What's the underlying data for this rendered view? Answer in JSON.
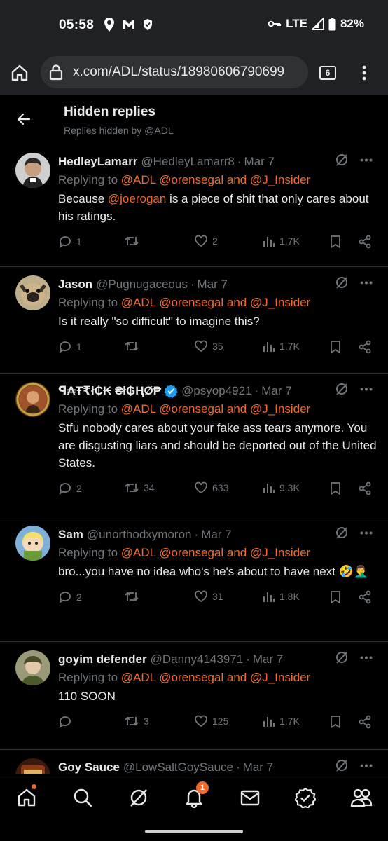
{
  "status_bar": {
    "time": "05:58",
    "network": "LTE",
    "battery": "82%"
  },
  "browser": {
    "url": "x.com/ADL/status/18980606790699",
    "tab_count": "6"
  },
  "header": {
    "title": "Hidden replies",
    "subtitle": "Replies hidden by @ADL"
  },
  "replies": [
    {
      "name": "HedleyLamarr",
      "handle": "@HedleyLamarr8",
      "date": "Mar 7",
      "replying_prefix": "Replying to",
      "replying_to": "@ADL @orensegal and @J_Insider",
      "text_parts": [
        "Because ",
        "@joerogan",
        " is a piece of shit that only cares about his ratings."
      ],
      "replies": "1",
      "reposts": "",
      "likes": "2",
      "views": "1.7K",
      "avatar_color": "#6b5a4a"
    },
    {
      "name": "Jason",
      "handle": "@Pugnugaceous",
      "date": "Mar 7",
      "replying_prefix": "Replying to",
      "replying_to": "@ADL @orensegal and @J_Insider",
      "text": "Is it really \"so difficult\" to imagine this?",
      "replies": "1",
      "reposts": "",
      "likes": "35",
      "views": "1.7K",
      "avatar_color": "#8a7a5e"
    },
    {
      "name": "ꟼ₳Ŧ₹ł₵₭ ₴ł₲ⱧØ₱",
      "handle": "@psyop4921",
      "date": "Mar 7",
      "replying_prefix": "Replying to",
      "replying_to": "@ADL @orensegal and @J_Insider",
      "text": "Stfu nobody cares about your fake ass tears anymore. You are disgusting liars and should be deported out of the United States.",
      "replies": "2",
      "reposts": "34",
      "likes": "633",
      "views": "9.3K",
      "avatar_color": "#7a4a2a"
    },
    {
      "name": "Sam",
      "handle": "@unorthodxymoron",
      "date": "Mar 7",
      "replying_prefix": "Replying to",
      "replying_to": "@ADL @orensegal and @J_Insider",
      "text": "bro...you have no idea who's he's about to have next 🤣🤦‍♂️",
      "replies": "2",
      "reposts": "",
      "likes": "31",
      "views": "1.8K",
      "avatar_color": "#d8c9a8"
    },
    {
      "name": "goyim defender",
      "handle": "@Danny4143971",
      "date": "Mar 7",
      "replying_prefix": "Replying to",
      "replying_to": "@ADL @orensegal and @J_Insider",
      "text": "110 SOON",
      "replies": "",
      "reposts": "3",
      "likes": "125",
      "views": "1.7K",
      "avatar_color": "#6a6a4a"
    },
    {
      "name": "Goy Sauce",
      "handle": "@LowSaltGoySauce",
      "date": "Mar 7",
      "avatar_color": "#7a3a20"
    }
  ],
  "bottom_nav": {
    "notification_count": "1"
  },
  "icons": [
    "home-icon",
    "search-icon",
    "grok-icon",
    "bell-icon",
    "mail-icon",
    "verified-icon",
    "people-icon"
  ],
  "colors": {
    "mention": "#f26a2b",
    "muted": "#71767b",
    "verified": "#1d9bf0"
  }
}
